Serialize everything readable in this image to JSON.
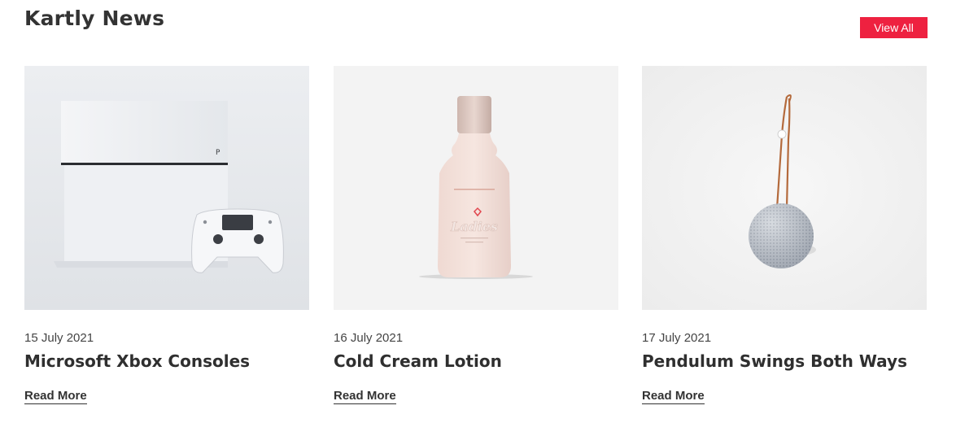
{
  "section": {
    "title": "Kartly News",
    "view_all_label": "View All",
    "accent_color": "#ee2140"
  },
  "articles": [
    {
      "date": "15 July 2021",
      "title": "Microsoft Xbox Consoles",
      "link_label": "Read More",
      "image": "game-console-photo"
    },
    {
      "date": "16 July 2021",
      "title": "Cold Cream Lotion",
      "link_label": "Read More",
      "image": "lotion-bottle-photo",
      "image_text": "Ladies"
    },
    {
      "date": "17 July 2021",
      "title": "Pendulum Swings Both Ways",
      "link_label": "Read More",
      "image": "speaker-photo"
    }
  ]
}
